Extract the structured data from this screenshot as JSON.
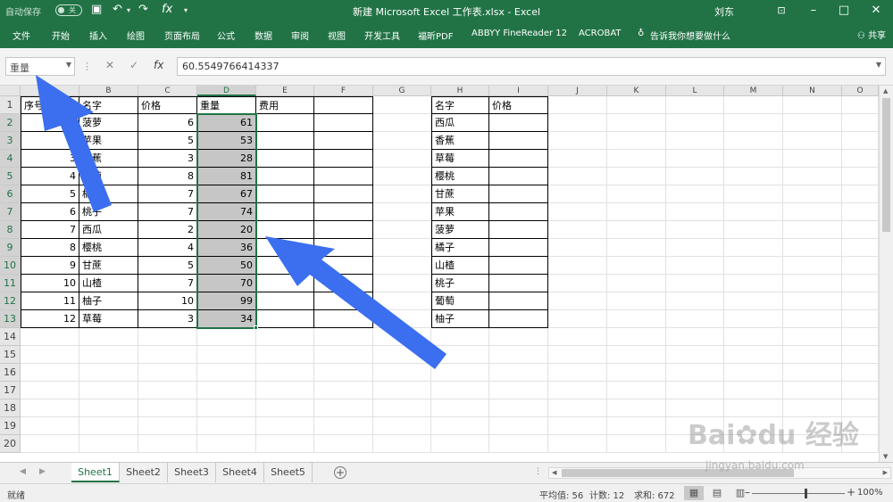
{
  "titlebar": {
    "autosave_label": "自动保存",
    "autosave_state": "关",
    "document_title": "新建 Microsoft Excel 工作表.xlsx  -  Excel",
    "user_name": "刘东"
  },
  "ribbon": {
    "tabs": [
      "文件",
      "开始",
      "插入",
      "绘图",
      "页面布局",
      "公式",
      "数据",
      "审阅",
      "视图",
      "开发工具",
      "福昕PDF",
      "ABBYY FineReader 12",
      "ACROBAT",
      "告诉我你想要做什么"
    ],
    "share_label": "共享"
  },
  "formula_bar": {
    "name_box": "重量",
    "fx_label": "fx",
    "value": "60.5549766414337"
  },
  "columns": [
    "A",
    "B",
    "C",
    "D",
    "E",
    "F",
    "G",
    "H",
    "I",
    "J",
    "K",
    "L",
    "M",
    "N",
    "O"
  ],
  "rows": [
    "1",
    "2",
    "3",
    "4",
    "5",
    "6",
    "7",
    "8",
    "9",
    "10",
    "11",
    "12",
    "13",
    "14",
    "15",
    "16",
    "17",
    "18",
    "19",
    "20"
  ],
  "table1": {
    "headers": [
      "序号",
      "名字",
      "价格",
      "重量",
      "费用",
      ""
    ],
    "rows": [
      [
        "1",
        "菠萝",
        "6",
        "61",
        "",
        ""
      ],
      [
        "2",
        "苹果",
        "5",
        "53",
        "",
        ""
      ],
      [
        "3",
        "香蕉",
        "3",
        "28",
        "",
        ""
      ],
      [
        "4",
        "葡萄",
        "8",
        "81",
        "",
        ""
      ],
      [
        "5",
        "橘子",
        "7",
        "67",
        "",
        ""
      ],
      [
        "6",
        "桃子",
        "7",
        "74",
        "",
        ""
      ],
      [
        "7",
        "西瓜",
        "2",
        "20",
        "",
        ""
      ],
      [
        "8",
        "樱桃",
        "4",
        "36",
        "",
        ""
      ],
      [
        "9",
        "甘蔗",
        "5",
        "50",
        "",
        ""
      ],
      [
        "10",
        "山楂",
        "7",
        "70",
        "",
        ""
      ],
      [
        "11",
        "柚子",
        "10",
        "99",
        "",
        ""
      ],
      [
        "12",
        "草莓",
        "3",
        "34",
        "",
        ""
      ]
    ]
  },
  "table2": {
    "headers": [
      "名字",
      "价格"
    ],
    "names": [
      "西瓜",
      "香蕉",
      "草莓",
      "樱桃",
      "甘蔗",
      "苹果",
      "菠萝",
      "橘子",
      "山楂",
      "桃子",
      "葡萄",
      "柚子"
    ]
  },
  "sheets": [
    "Sheet1",
    "Sheet2",
    "Sheet3",
    "Sheet4",
    "Sheet5"
  ],
  "active_sheet": "Sheet1",
  "statusbar": {
    "ready": "就绪",
    "average": "平均值: 56",
    "count": "计数: 12",
    "sum": "求和: 672",
    "zoom": "100%"
  },
  "watermark": {
    "url": "jingyan.baidu.com"
  },
  "colors": {
    "accent": "#217346",
    "arrow": "#3b6ff0",
    "selection": "#c6c6c6"
  }
}
